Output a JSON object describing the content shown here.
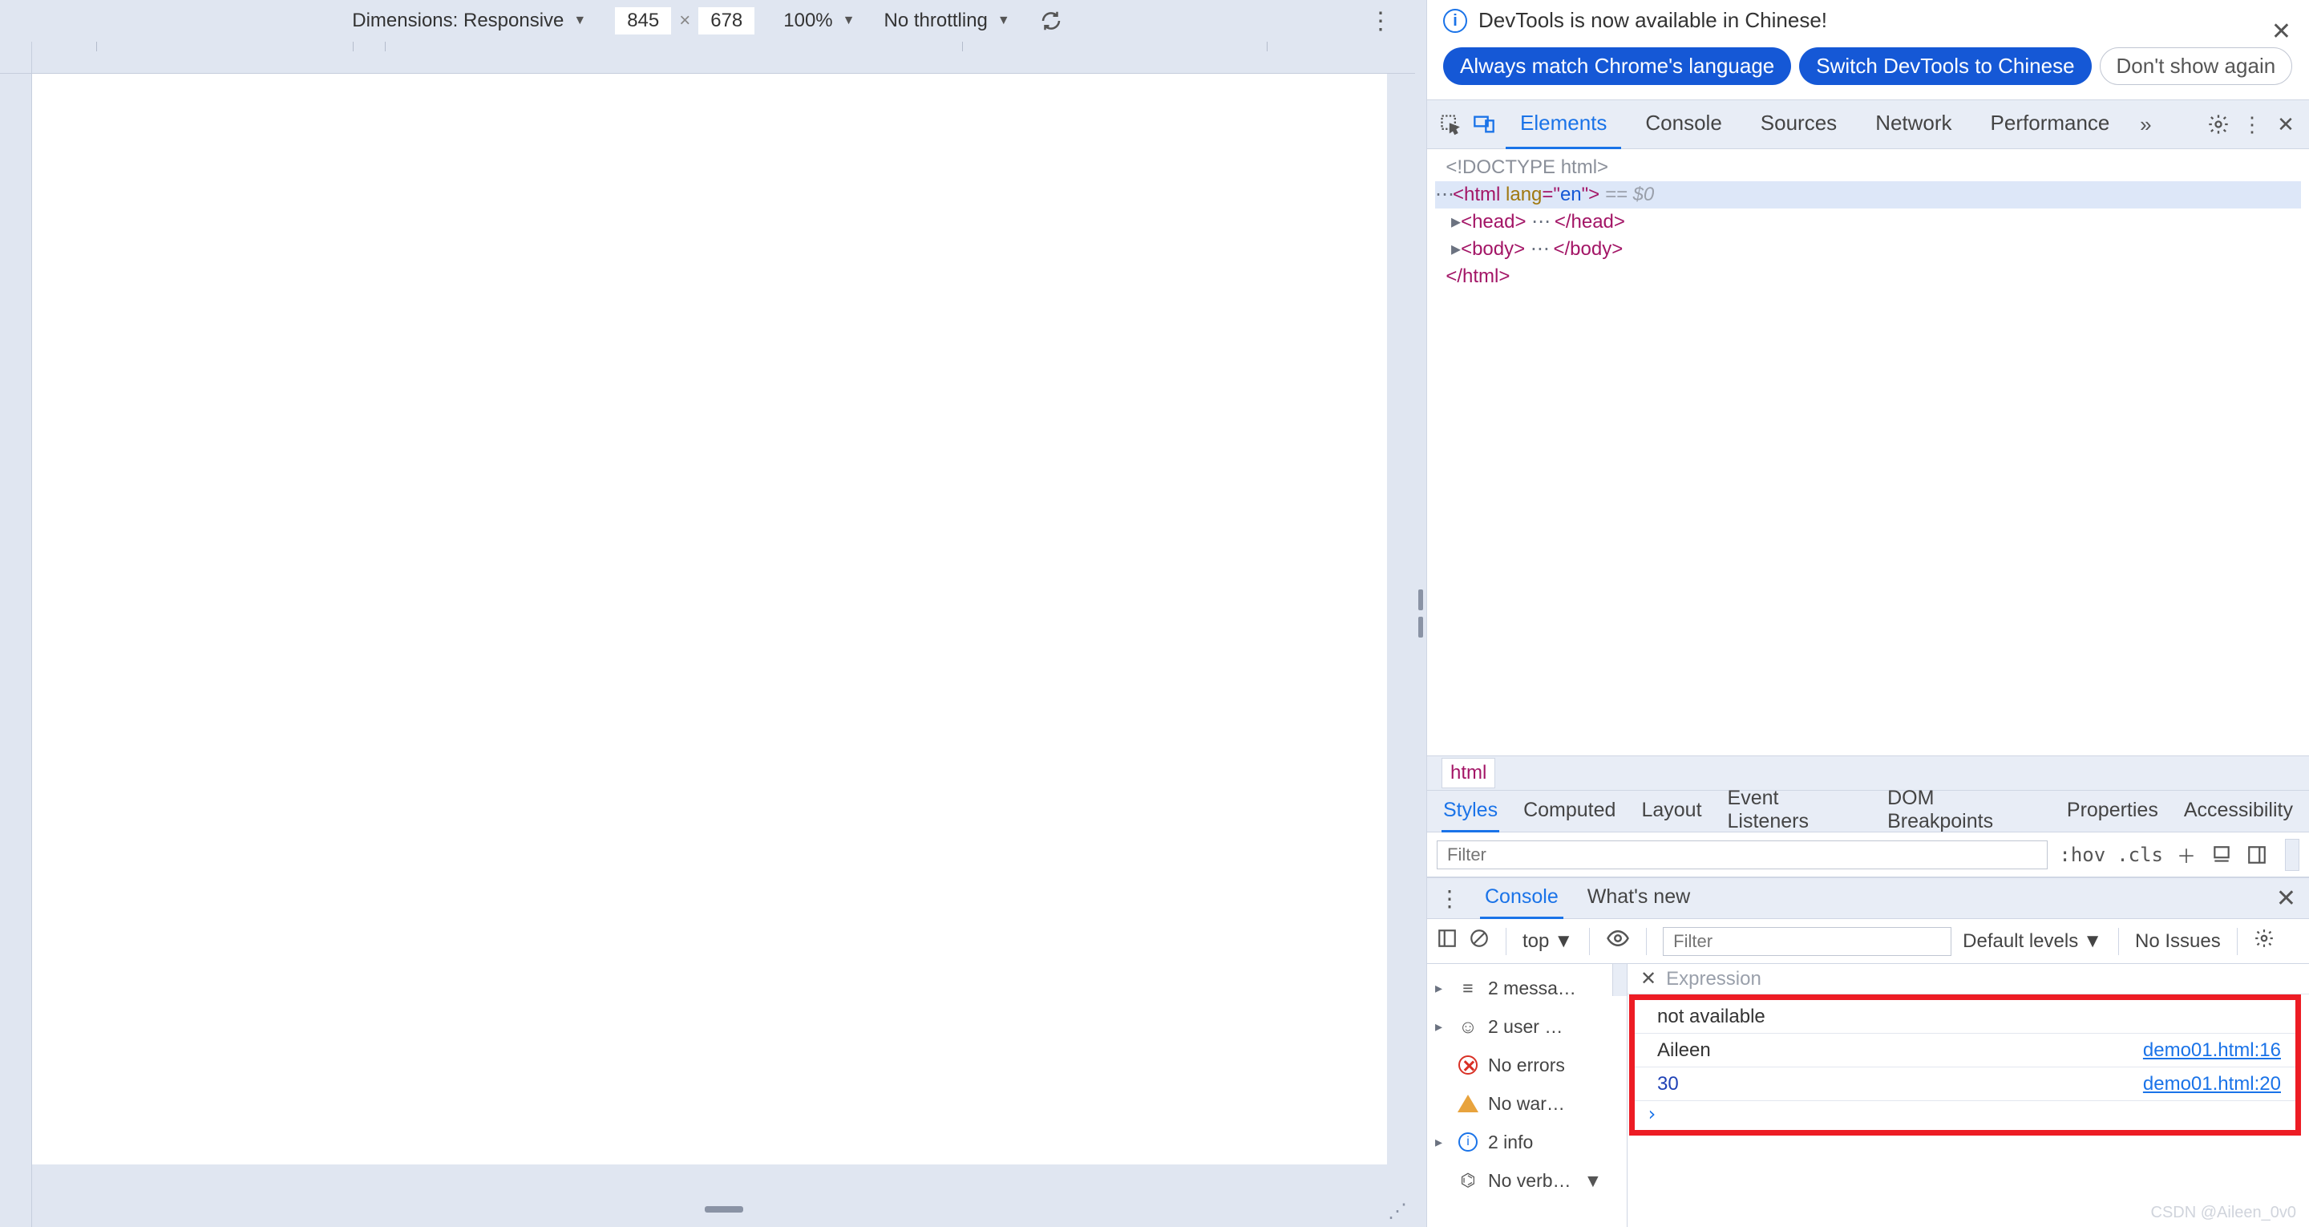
{
  "device_toolbar": {
    "dimensions_label": "Dimensions: Responsive",
    "width": "845",
    "height": "678",
    "separator": "×",
    "zoom": "100%",
    "throttling": "No throttling"
  },
  "infobar": {
    "message": "DevTools is now available in Chinese!",
    "btn_match": "Always match Chrome's language",
    "btn_switch": "Switch DevTools to Chinese",
    "btn_dont_show": "Don't show again"
  },
  "tabs": {
    "elements": "Elements",
    "console": "Console",
    "sources": "Sources",
    "network": "Network",
    "performance": "Performance"
  },
  "dom": {
    "doctype": "<!DOCTYPE html>",
    "html_open_prefix": "<html ",
    "html_attr_name": "lang",
    "html_attr_eq": "=\"",
    "html_attr_val": "en",
    "html_open_suffix": "\">",
    "sel_suffix": " == $0",
    "head_open": "<head>",
    "ellipsis": "⋯",
    "head_close": "</head>",
    "body_open": "<body>",
    "body_close": "</body>",
    "html_close": "</html>"
  },
  "crumb": {
    "html": "html"
  },
  "subtabs": {
    "styles": "Styles",
    "computed": "Computed",
    "layout": "Layout",
    "event_listeners": "Event Listeners",
    "dom_breakpoints": "DOM Breakpoints",
    "properties": "Properties",
    "accessibility": "Accessibility"
  },
  "styles_bar": {
    "filter_placeholder": "Filter",
    "hov": ":hov",
    "cls": ".cls"
  },
  "drawer": {
    "console": "Console",
    "whats_new": "What's new"
  },
  "console_toolbar": {
    "context": "top",
    "filter_placeholder": "Filter",
    "levels": "Default levels",
    "issues": "No Issues"
  },
  "console_sidebar": {
    "messages": "2 messa…",
    "user": "2 user …",
    "errors": "No errors",
    "warnings": "No war…",
    "info": "2 info",
    "verbose": "No verb…"
  },
  "expression": {
    "placeholder": "Expression",
    "result": "not available"
  },
  "console_log": [
    {
      "value": "Aileen",
      "is_number": false,
      "source": "demo01.html:16"
    },
    {
      "value": "30",
      "is_number": true,
      "source": "demo01.html:20"
    }
  ],
  "prompt": "›",
  "watermark": "CSDN @Aileen_0v0"
}
